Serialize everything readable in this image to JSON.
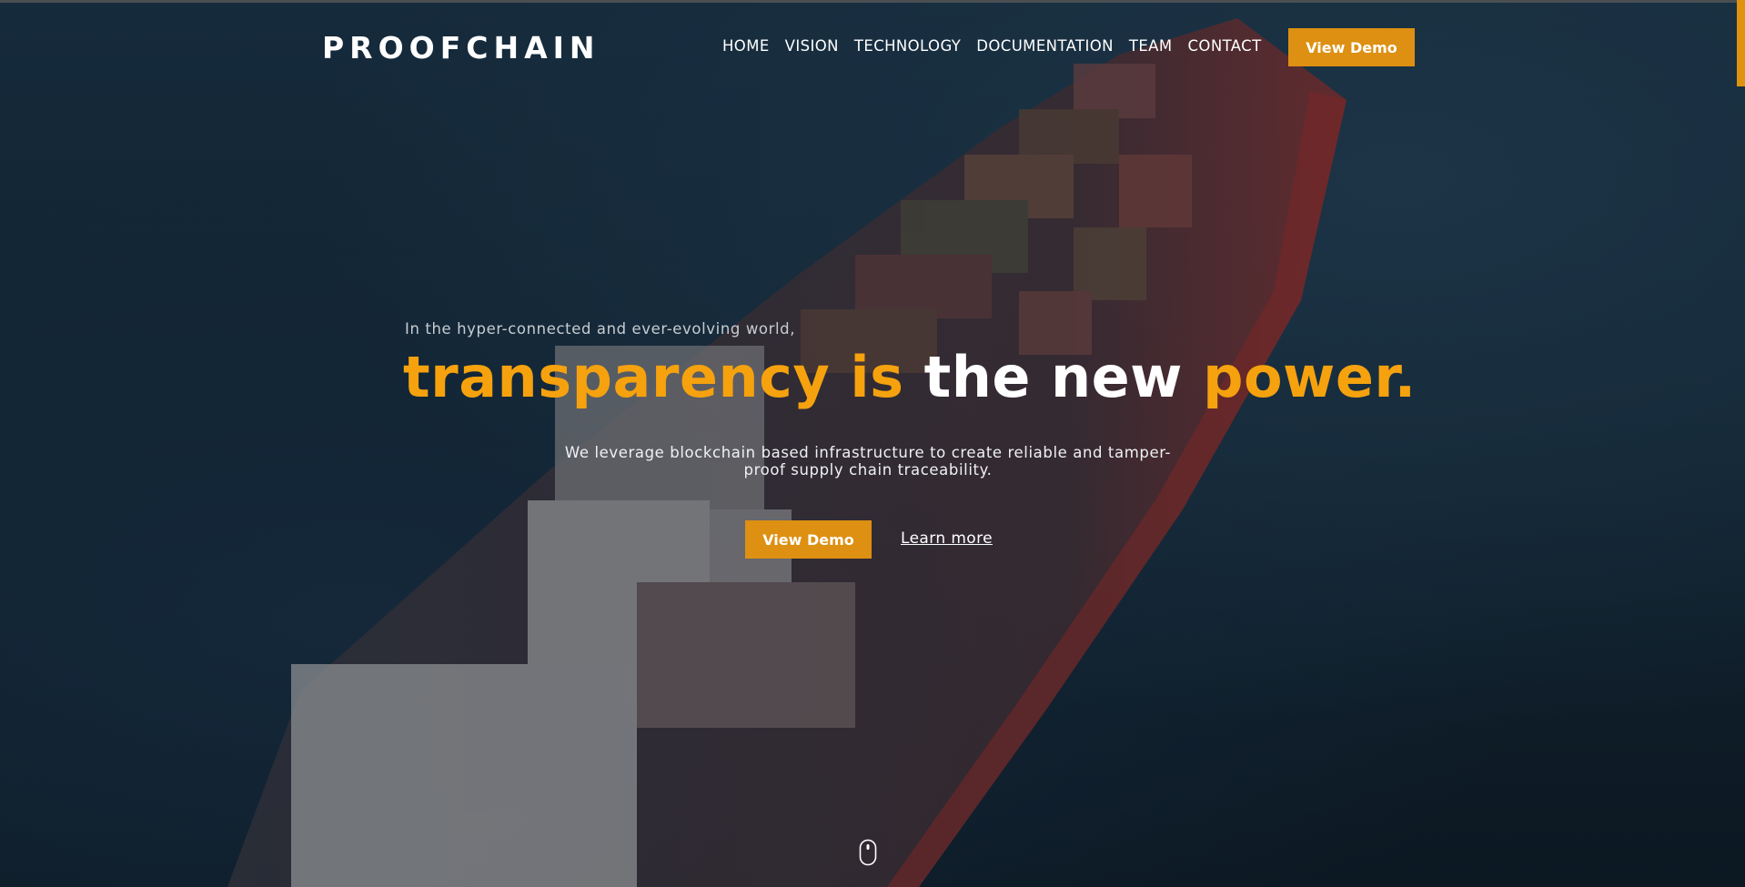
{
  "brand": {
    "name": "PROOFCHAIN"
  },
  "nav": {
    "items": [
      {
        "label": "HOME"
      },
      {
        "label": "VISION"
      },
      {
        "label": "TECHNOLOGY"
      },
      {
        "label": "DOCUMENTATION"
      },
      {
        "label": "TEAM"
      },
      {
        "label": "CONTACT"
      }
    ],
    "cta_label": "View Demo"
  },
  "hero": {
    "kicker": "In the hyper-connected and ever-evolving world,",
    "headline": {
      "part1": "transparency is",
      "part2": "the new",
      "part3": "power."
    },
    "description": "We leverage blockchain based infrastructure to create reliable and tamper-proof supply chain traceability.",
    "cta_label": "View Demo",
    "secondary_link": "Learn more"
  },
  "icons": {
    "scroll": "mouse-scroll-icon"
  },
  "colors": {
    "accent": "#f5a20e",
    "button": "#dd9012",
    "background": "#11222f"
  }
}
